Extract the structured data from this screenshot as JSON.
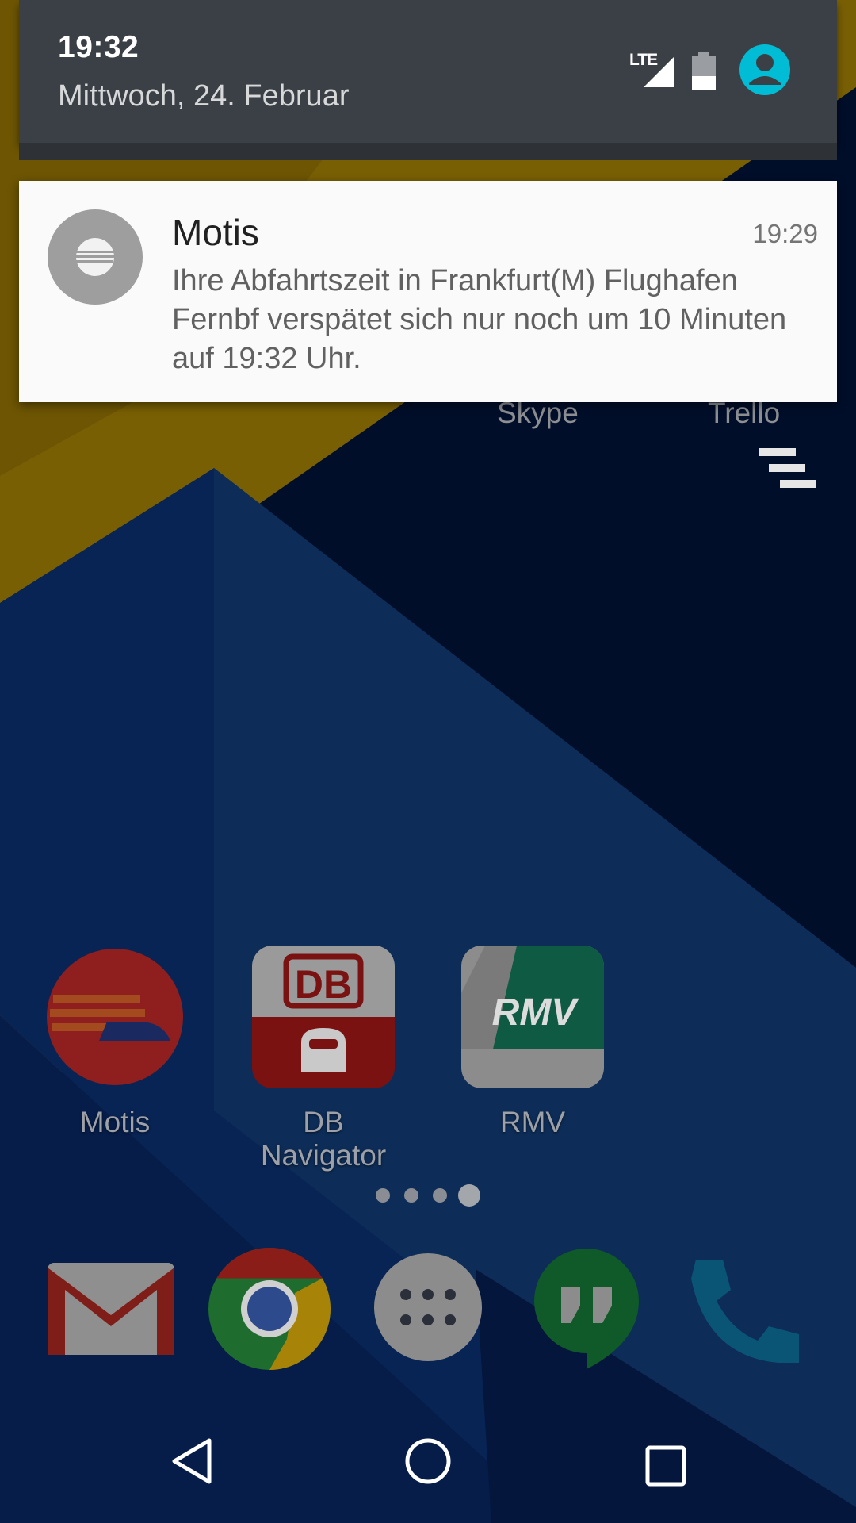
{
  "status_bar": {
    "time": "19:32",
    "date": "Mittwoch, 24. Februar",
    "network_label": "LTE",
    "icons": [
      "lte-signal-icon",
      "battery-icon",
      "account-icon"
    ],
    "account_color": "#00bcd4"
  },
  "notification": {
    "app_name": "Motis",
    "time": "19:29",
    "text": "Ihre Abfahrtszeit in Frankfurt(M) Flughafen Fernbf verspätet sich nur noch um 10 Minuten auf 19:32 Uhr.",
    "icon": "train-icon"
  },
  "widgets": [
    {
      "label": "Skype"
    },
    {
      "label": "Trello"
    }
  ],
  "home_apps": [
    {
      "label": "Motis",
      "icon": "motis-icon"
    },
    {
      "label": "DB Navigator",
      "icon": "db-navigator-icon"
    },
    {
      "label": "RMV",
      "icon": "rmv-icon"
    }
  ],
  "db_logo_text": "DB",
  "rmv_logo_text": "RMV",
  "pager": {
    "count": 4,
    "active": 4
  },
  "dock": [
    "gmail-icon",
    "chrome-icon",
    "app-drawer-icon",
    "hangouts-icon",
    "phone-icon"
  ],
  "nav": [
    "back-icon",
    "home-icon",
    "recents-icon"
  ],
  "colors": {
    "shade": "#3b4046",
    "card": "#fafafa",
    "wallpaper_yellow": "#c39a0a",
    "wallpaper_blue": "#0f3c8c",
    "wallpaper_navy": "#021845"
  }
}
